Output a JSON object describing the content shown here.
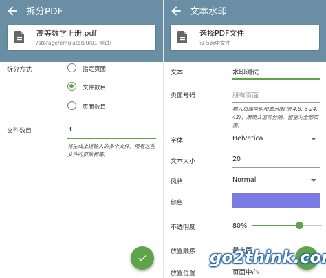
{
  "colors": {
    "appbar": "#6a8fa5",
    "accent": "#5fa34b",
    "swatch": "#7b79e3",
    "watermark": "#1f5f9e"
  },
  "split_screen": {
    "title": "拆分PDF",
    "file": {
      "name": "高等数学上册.pdf",
      "path": "/storage/emulated/0/01-测试/"
    },
    "split_mode": {
      "label": "拆分方式",
      "options": [
        "指定页面",
        "文件数目",
        "页面数目"
      ],
      "selected": "文件数目"
    },
    "file_count": {
      "label": "文件数目",
      "value": "3",
      "helper": "将生成上述输入的多个文件。所有这些文件的页数相等。"
    },
    "confirm_icon": "check-icon"
  },
  "watermark_screen": {
    "title": "文本水印",
    "file": {
      "name": "选择PDF文件",
      "path": "没有选中文件"
    },
    "text": {
      "label": "文本",
      "value": "水印测试"
    },
    "pages": {
      "label": "页面号码",
      "placeholder": "所有页面",
      "helper": "输入页面号码和或范围(例 4,8, 6-24, 42)，用英文逗号分隔。留空为全部页面。"
    },
    "font": {
      "label": "字体",
      "value": "Helvetica"
    },
    "size": {
      "label": "文本大小",
      "value": "20"
    },
    "style": {
      "label": "风格",
      "value": "Normal"
    },
    "color": {
      "label": "颜色",
      "value": "#7b79e3"
    },
    "opacity": {
      "label": "不透明度",
      "value": "80%",
      "level": 0.8
    },
    "order": {
      "label": "放置顺序",
      "value": "最上面"
    },
    "position": {
      "label": "放置位置",
      "value": "页面中心"
    },
    "confirm_icon": "check-icon"
  },
  "watermark_text": "go2think.com"
}
